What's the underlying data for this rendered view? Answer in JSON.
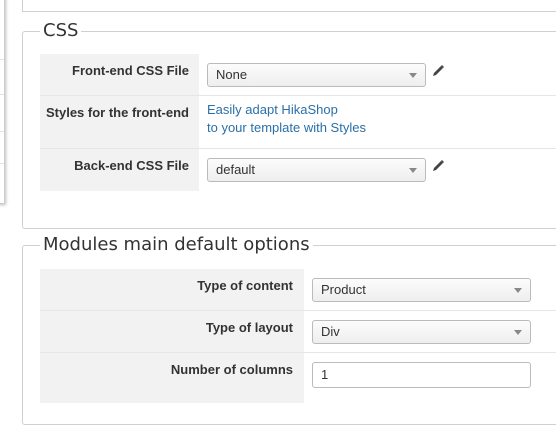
{
  "css_section": {
    "legend": "CSS",
    "frontend_css": {
      "label": "Front-end CSS File",
      "value": "None"
    },
    "styles": {
      "label": "Styles for the front-end",
      "link_line1": "Easily adapt HikaShop",
      "link_line2": "to your template with Styles"
    },
    "backend_css": {
      "label": "Back-end CSS File",
      "value": "default"
    }
  },
  "modules_section": {
    "legend": "Modules main default options",
    "type_of_content": {
      "label": "Type of content",
      "value": "Product"
    },
    "type_of_layout": {
      "label": "Type of layout",
      "value": "Div"
    },
    "number_of_columns": {
      "label": "Number of columns",
      "value": "1"
    }
  },
  "icons": {
    "edit": "pencil-icon",
    "dropdown": "chevron-down-icon"
  }
}
